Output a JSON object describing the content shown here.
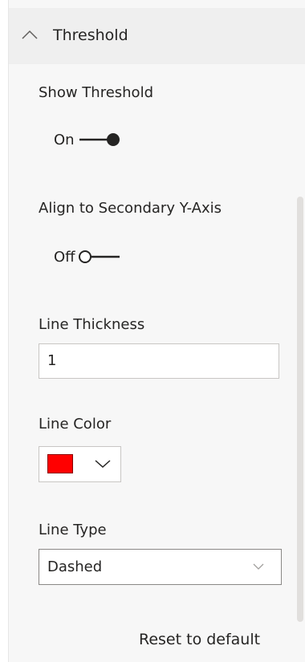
{
  "section": {
    "title": "Threshold"
  },
  "show_threshold": {
    "label": "Show Threshold",
    "state": "On"
  },
  "align_secondary": {
    "label": "Align to Secondary Y-Axis",
    "state": "Off"
  },
  "line_thickness": {
    "label": "Line Thickness",
    "value": "1"
  },
  "line_color": {
    "label": "Line Color",
    "color": "#ff0000"
  },
  "line_type": {
    "label": "Line Type",
    "value": "Dashed"
  },
  "reset": {
    "label": "Reset to default"
  }
}
